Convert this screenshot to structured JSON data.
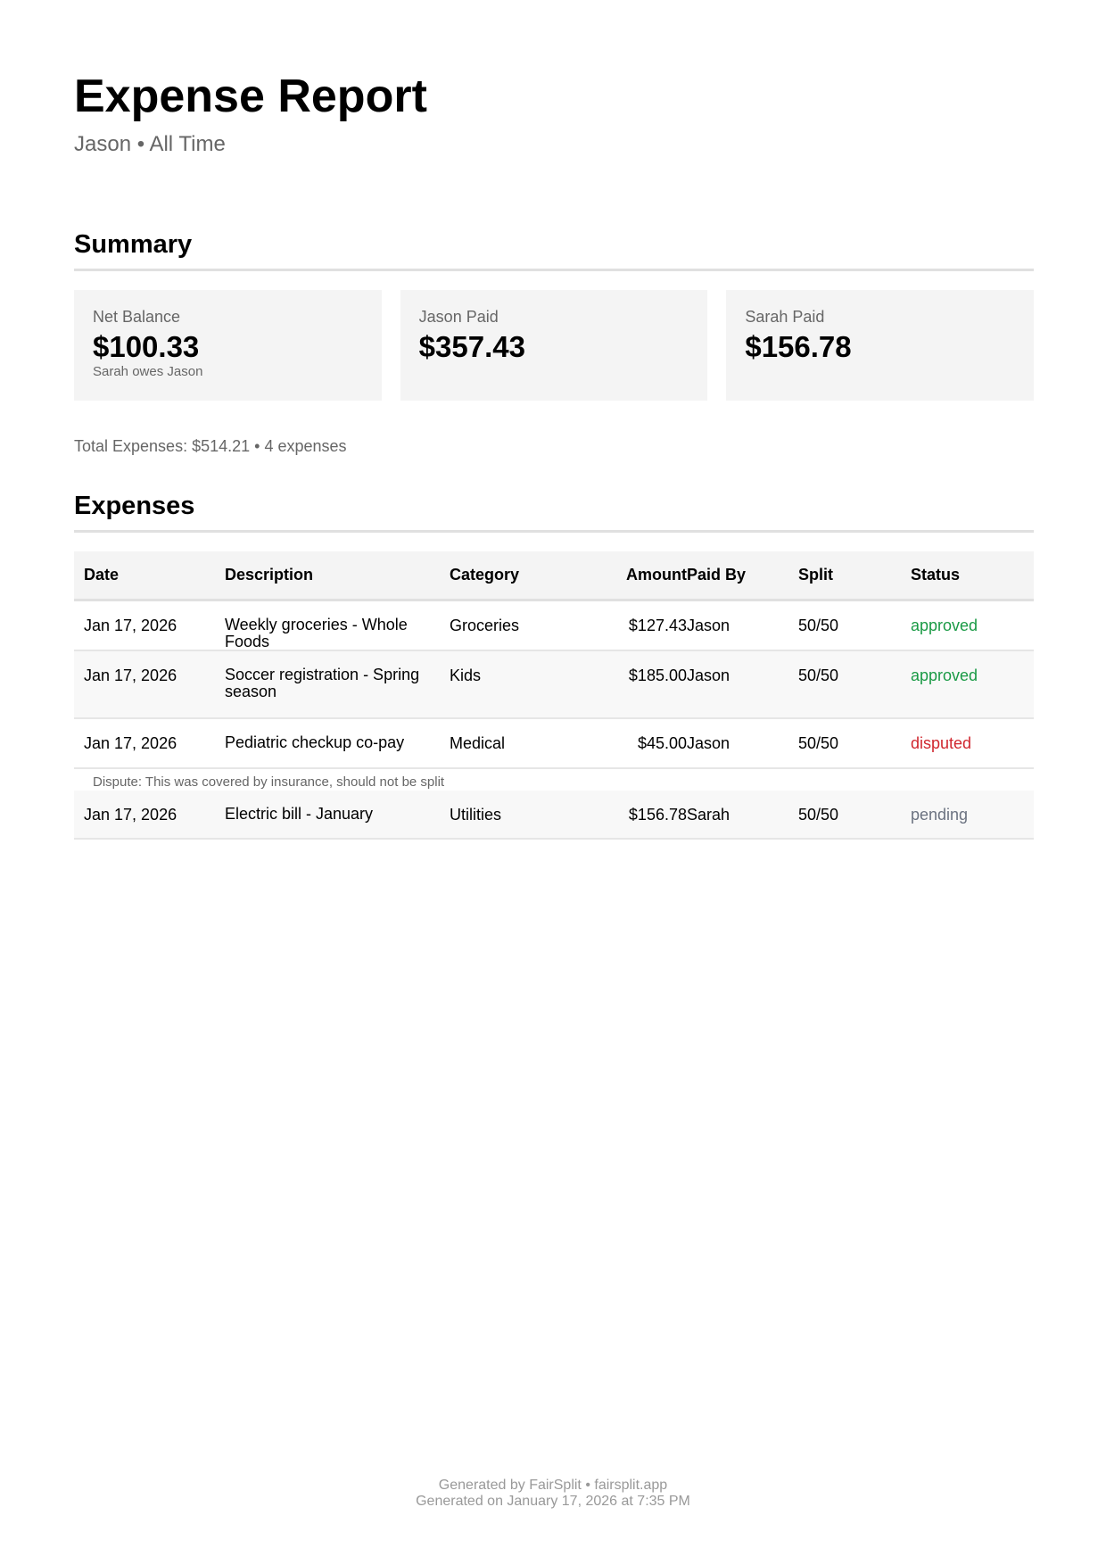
{
  "header": {
    "title": "Expense Report",
    "subtitle": "Jason • All Time"
  },
  "summary": {
    "heading": "Summary",
    "cards": [
      {
        "label": "Net Balance",
        "value": "$100.33",
        "sub": "Sarah owes Jason"
      },
      {
        "label": "Jason Paid",
        "value": "$357.43"
      },
      {
        "label": "Sarah Paid",
        "value": "$156.78"
      }
    ],
    "totals": "Total Expenses: $514.21 • 4 expenses"
  },
  "expenses": {
    "heading": "Expenses",
    "columns": {
      "date": "Date",
      "description": "Description",
      "category": "Category",
      "amount": "Amount",
      "paid_by": "Paid By",
      "split": "Split",
      "status": "Status"
    },
    "rows": [
      {
        "date": "Jan 17, 2026",
        "description": "Weekly groceries - Whole Foods",
        "category": "Groceries",
        "amount": "$127.43",
        "paid_by": "Jason",
        "split": "50/50",
        "status": "approved"
      },
      {
        "date": "Jan 17, 2026",
        "description": "Soccer registration - Spring season",
        "category": "Kids",
        "amount": "$185.00",
        "paid_by": "Jason",
        "split": "50/50",
        "status": "approved"
      },
      {
        "date": "Jan 17, 2026",
        "description": "Pediatric checkup co-pay",
        "category": "Medical",
        "amount": "$45.00",
        "paid_by": "Jason",
        "split": "50/50",
        "status": "disputed",
        "note": "Dispute: This was covered by insurance, should not be split"
      },
      {
        "date": "Jan 17, 2026",
        "description": "Electric bill - January",
        "category": "Utilities",
        "amount": "$156.78",
        "paid_by": "Sarah",
        "split": "50/50",
        "status": "pending"
      }
    ]
  },
  "colors": {
    "approved": "#1a9a45",
    "disputed": "#d0262e",
    "pending": "#6b7280"
  },
  "footer": {
    "line1": "Generated by FairSplit • fairsplit.app",
    "line2": "Generated on January 17, 2026 at 7:35 PM"
  }
}
